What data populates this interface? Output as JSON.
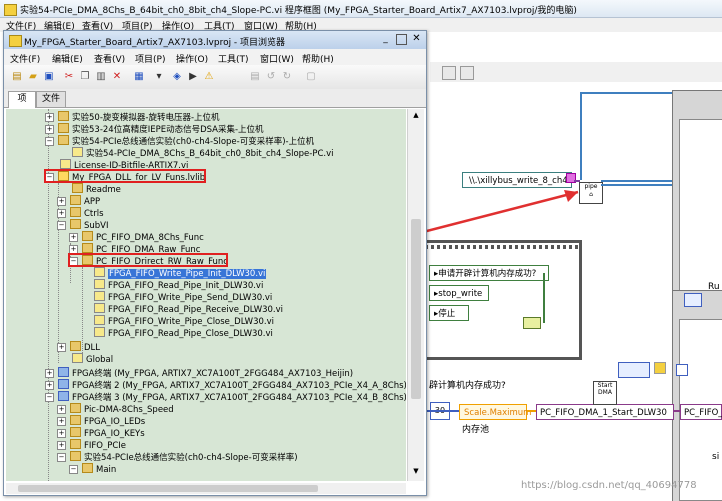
{
  "outer": {
    "title": "实验54-PCIe_DMA_8Chs_B_64bit_ch0_8bit_ch4_Slope-PC.vi 程序框图 (My_FPGA_Starter_Board_Artix7_AX7103.lvproj/我的电脑)",
    "menu": [
      "文件(F)",
      "编辑(E)",
      "查看(V)",
      "项目(P)",
      "操作(O)",
      "工具(T)",
      "窗口(W)",
      "帮助(H)"
    ]
  },
  "project": {
    "title": "My_FPGA_Starter_Board_Artix7_AX7103.lvproj - 项目浏览器",
    "menu": [
      "文件(F)",
      "编辑(E)",
      "查看(V)",
      "项目(P)",
      "操作(O)",
      "工具(T)",
      "窗口(W)",
      "帮助(H)"
    ],
    "tabs": [
      "项",
      "文件"
    ],
    "tree": [
      "实验50-旋变模拟器-旋转电压器-上位机",
      "实验53-24位高精度IEPE动态信号DSA采集-上位机",
      "实验54-PCIe总线通信实验(ch0-ch4-Slope-可变采样率)-上位机",
      "实验54-PCIe_DMA_8Chs_B_64bit_ch0_8bit_ch4_Slope-PC.vi",
      "License-ID-Bitfile-ARTIX7.vi",
      "My_FPGA_DLL_for_LV_Funs.lvlib",
      "Readme",
      "APP",
      "Ctrls",
      "SubVI",
      "PC_FIFO_DMA_8Chs_Func",
      "PC_FIFO_DMA_Raw_Func",
      "PC_FIFO_Drirect_RW_Raw_Func",
      "FPGA_FIFO_Write_Pipe_Init_DLW30.vi",
      "FPGA_FIFO_Read_Pipe_Init_DLW30.vi",
      "FPGA_FIFO_Write_Pipe_Send_DLW30.vi",
      "FPGA_FIFO_Read_Pipe_Receive_DLW30.vi",
      "FPGA_FIFO_Write_Pipe_Close_DLW30.vi",
      "FPGA_FIFO_Read_Pipe_Close_DLW30.vi",
      "DLL",
      "Global",
      "FPGA终端 (My_FPGA, ARTIX7_XC7A100T_2FGG484_AX7103_Heijin)",
      "FPGA终端 2 (My_FPGA, ARTIX7_XC7A100T_2FGG484_AX7103_PCIe_X4_A_8Chs)",
      "FPGA终端 3 (My_FPGA, ARTIX7_XC7A100T_2FGG484_AX7103_PCIe_X4_B_8Chs)",
      "Pic-DMA-8Chs_Speed",
      "FPGA_IO_LEDs",
      "FPGA_IO_KEYs",
      "FIFO_PCIe",
      "实验54-PCIe总线通信实验(ch0-ch4-Slope-可变采样率)",
      "Main"
    ]
  },
  "diagram": {
    "path_const": "\\\\.\\xillybus_write_8_ch4",
    "case1": "申请开辟计算机内存成功?",
    "case2": "stop_write",
    "case3": "停止",
    "label_mem": "辟计算机内存成功?",
    "node_scale": "Scale.Maximum",
    "label_pool": "内存池",
    "node_start": "PC_FIFO_DMA_1_Start_DLW30",
    "node_right": "PC_FIFO_D",
    "start_icon": "Start",
    "start_icon2": "DMA",
    "num_30": "30",
    "ru": "Ru",
    "si": "si",
    "watermark": "https://blog.csdn.net/qq_40694778"
  }
}
